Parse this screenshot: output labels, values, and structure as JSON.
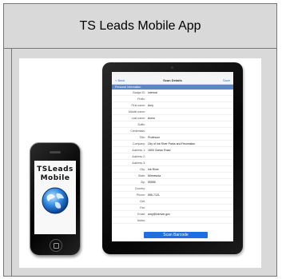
{
  "title": "TS Leads Mobile App",
  "ipad": {
    "nav_back": "< Back",
    "nav_title": "Scan Details",
    "nav_save": "Save",
    "section": "Personal Information",
    "fields": [
      {
        "label": "Badge ID:",
        "value": "Internal"
      },
      {
        "label": "Prefix:",
        "value": ""
      },
      {
        "label": "First name:",
        "value": "Amy"
      },
      {
        "label": "Middle name:",
        "value": ""
      },
      {
        "label": "Last name:",
        "value": "Avers"
      },
      {
        "label": "Suffix:",
        "value": ""
      },
      {
        "label": "Credentials:",
        "value": ""
      },
      {
        "label": "Title:",
        "value": "Professor"
      },
      {
        "label": "Company:",
        "value": "City of Ink River Parks and Recreation"
      },
      {
        "label": "Address 1:",
        "value": "1600 Ocean Road"
      },
      {
        "label": "Address 2:",
        "value": ""
      },
      {
        "label": "Address 3:",
        "value": ""
      },
      {
        "label": "City:",
        "value": "Ink River"
      },
      {
        "label": "State:",
        "value": "Minnesota"
      },
      {
        "label": "Zip:",
        "value": "55555"
      },
      {
        "label": "Country:",
        "value": ""
      },
      {
        "label": "Phone:",
        "value": "555-7121"
      },
      {
        "label": "Cell:",
        "value": ""
      },
      {
        "label": "Fax:",
        "value": ""
      },
      {
        "label": "Email:",
        "value": "amy@inkriver.gov"
      },
      {
        "label": "Notes:",
        "value": ""
      }
    ],
    "scan_button": "Scan Barcode"
  },
  "iphone": {
    "brand_line1": "TSLeads",
    "brand_line2": "Mobile"
  }
}
